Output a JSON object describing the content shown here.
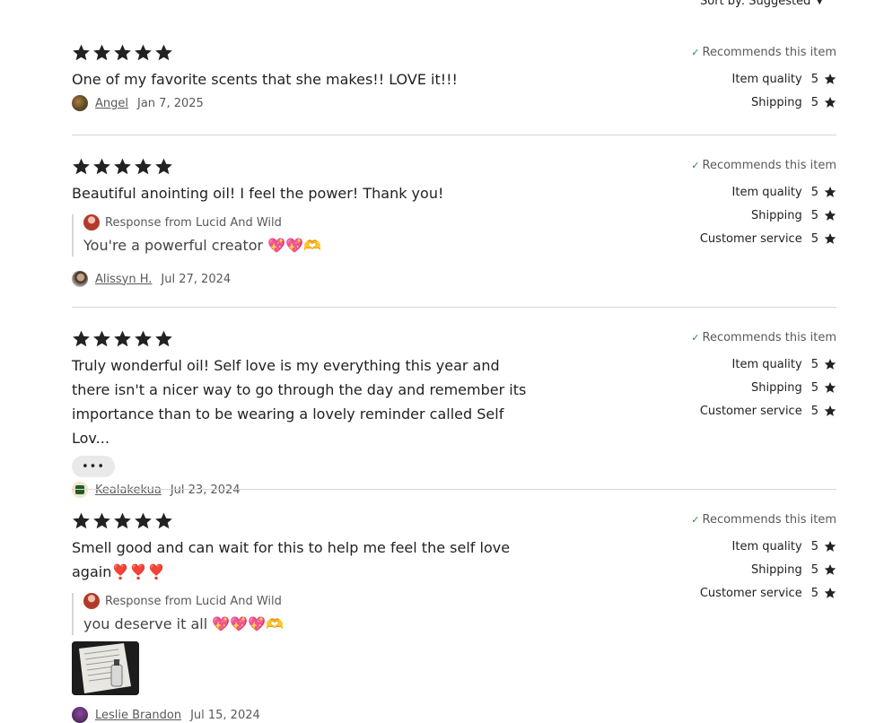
{
  "sort": {
    "label": "Sort by: Suggested"
  },
  "reviews": [
    {
      "text": "One of my favorite scents that she makes!! LOVE it!!!",
      "author": "Angel",
      "date": "Jan 7, 2025",
      "recommend": "Recommends this item",
      "ratings": [
        {
          "label": "Item quality",
          "value": "5"
        },
        {
          "label": "Shipping",
          "value": "5"
        }
      ]
    },
    {
      "text": "Beautiful anointing oil! I feel the power! Thank you!",
      "response_from": "Response from Lucid And Wild",
      "response_text": "You're a powerful creator 💖💖🫶",
      "author": "Alissyn H.",
      "date": "Jul 27, 2024",
      "recommend": "Recommends this item",
      "ratings": [
        {
          "label": "Item quality",
          "value": "5"
        },
        {
          "label": "Shipping",
          "value": "5"
        },
        {
          "label": "Customer service",
          "value": "5"
        }
      ]
    },
    {
      "text": "Truly wonderful oil! Self love is my everything this year and there isn't a nicer way to go through the day and remember its importance than to be wearing a lovely reminder called Self Lov...",
      "more_label": "•••",
      "author": "Kealakekua",
      "date": "Jul 23, 2024",
      "recommend": "Recommends this item",
      "ratings": [
        {
          "label": "Item quality",
          "value": "5"
        },
        {
          "label": "Shipping",
          "value": "5"
        },
        {
          "label": "Customer service",
          "value": "5"
        }
      ]
    },
    {
      "text": "Smell good and can wait for this to help me feel the self love again❣️❣️❣️",
      "response_from": "Response from Lucid And Wild",
      "response_text": "you deserve it all 💖💖💖🫶",
      "author": "Leslie Brandon",
      "date": "Jul 15, 2024",
      "recommend": "Recommends this item",
      "ratings": [
        {
          "label": "Item quality",
          "value": "5"
        },
        {
          "label": "Shipping",
          "value": "5"
        },
        {
          "label": "Customer service",
          "value": "5"
        }
      ]
    }
  ]
}
